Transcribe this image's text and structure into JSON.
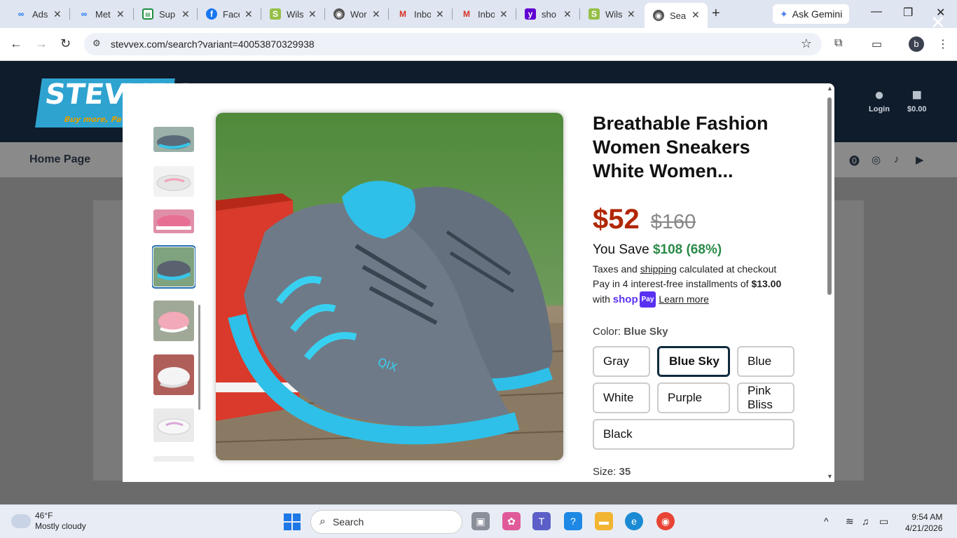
{
  "browser": {
    "tabs": [
      {
        "label": "Ads",
        "icon": "meta-icon",
        "active": false
      },
      {
        "label": "Met",
        "icon": "meta-icon",
        "active": false
      },
      {
        "label": "Sup",
        "icon": "sheet-icon",
        "active": false
      },
      {
        "label": "Face",
        "icon": "facebook-icon",
        "active": false
      },
      {
        "label": "Wils",
        "icon": "shopify-icon",
        "active": false
      },
      {
        "label": "Wor",
        "icon": "globe-icon",
        "active": false
      },
      {
        "label": "Inbo",
        "icon": "gmail-icon",
        "active": false
      },
      {
        "label": "Inbo",
        "icon": "gmail-icon",
        "active": false
      },
      {
        "label": "sho",
        "icon": "yahoo-icon",
        "active": false
      },
      {
        "label": "Wils",
        "icon": "shopify-icon",
        "active": false
      },
      {
        "label": "Sea",
        "icon": "globe-icon",
        "active": true
      }
    ],
    "ask_gemini": "Ask Gemini",
    "url": "stevvex.com/search?variant=40053870329938",
    "profile_initial": "b"
  },
  "site": {
    "logo_text": "STEVVEX",
    "logo_tagline": "Buy more, Pa",
    "login_label": "Login",
    "cart_total": "$0.00",
    "nav_home": "Home Page"
  },
  "product": {
    "title": "Breathable Fashion Women Sneakers White Women...",
    "price": "$52",
    "compare_price": "$160",
    "save_prefix": "You Save",
    "save_amount": "$108 (68%)",
    "tax_pre": "Taxes and",
    "tax_link": "shipping",
    "tax_post": "calculated at checkout",
    "installments_pre": "Pay in 4 interest-free installments of",
    "installments_amount": "$13.00",
    "with_text": "with",
    "shop_text": "shop",
    "pay_text": "Pay",
    "learn_more": "Learn more",
    "color_label": "Color:",
    "color_value": "Blue Sky",
    "colors": [
      "Gray",
      "Blue Sky",
      "Blue",
      "White",
      "Purple",
      "Pink Bliss",
      "Black"
    ],
    "selected_color": "Blue Sky",
    "size_label": "Size:",
    "size_value": "35"
  },
  "taskbar": {
    "temp": "46°F",
    "weather": "Mostly cloudy",
    "search_placeholder": "Search",
    "time": "9:54 AM",
    "date": "4/21/2026"
  }
}
